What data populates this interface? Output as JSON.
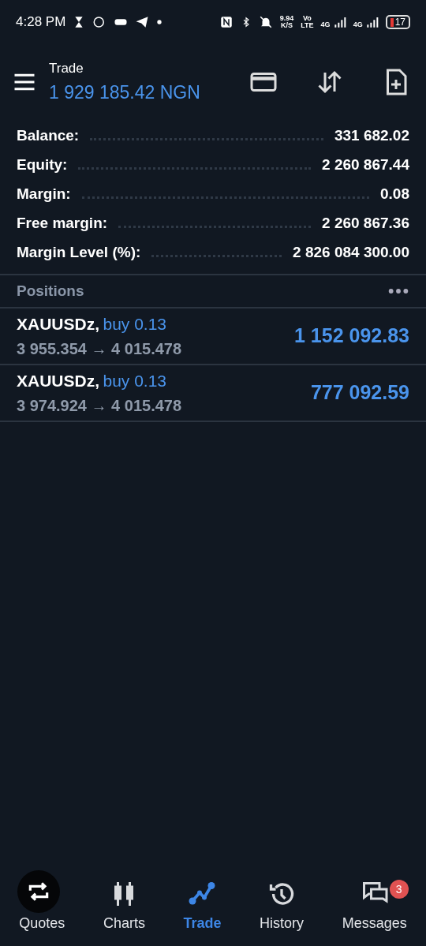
{
  "status_bar": {
    "time": "4:28 PM",
    "speed": "9.94",
    "speed_unit": "K/S",
    "volte_top": "Vo",
    "volte_bottom": "LTE",
    "net1": "4G",
    "net2": "4G",
    "battery": "17"
  },
  "header": {
    "title": "Trade",
    "balance": "1 929 185.42 NGN"
  },
  "summary": [
    {
      "label": "Balance:",
      "value": "331 682.02"
    },
    {
      "label": "Equity:",
      "value": "2 260 867.44"
    },
    {
      "label": "Margin:",
      "value": "0.08"
    },
    {
      "label": "Free margin:",
      "value": "2 260 867.36"
    },
    {
      "label": "Margin Level (%):",
      "value": "2 826 084 300.00"
    }
  ],
  "positions_title": "Positions",
  "positions": [
    {
      "symbol": "XAUUSDz,",
      "side": "buy 0.13",
      "prices": "3 955.354 → 4 015.478",
      "profit": "1 152 092.83"
    },
    {
      "symbol": "XAUUSDz,",
      "side": "buy 0.13",
      "prices": "3 974.924 → 4 015.478",
      "profit": "777 092.59"
    }
  ],
  "nav": [
    {
      "label": "Quotes",
      "kind": "quotes",
      "selected": false
    },
    {
      "label": "Charts",
      "kind": "charts",
      "selected": false
    },
    {
      "label": "Trade",
      "kind": "trade",
      "selected": true
    },
    {
      "label": "History",
      "kind": "history",
      "selected": false
    },
    {
      "label": "Messages",
      "kind": "messages",
      "selected": false,
      "badge": "3"
    }
  ]
}
